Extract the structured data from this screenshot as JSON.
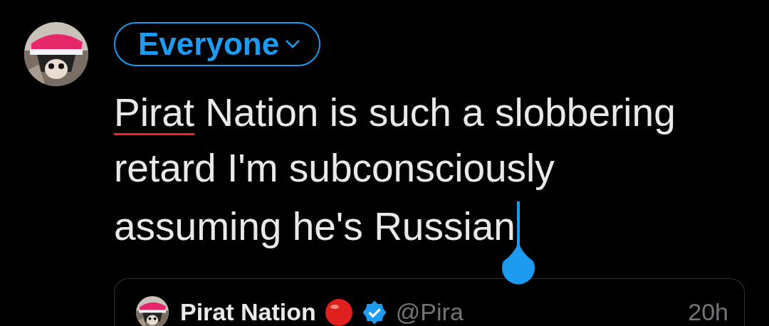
{
  "audience_button": {
    "label": "Everyone"
  },
  "compose": {
    "lines": [
      [
        {
          "text": "Pirat",
          "misspelled": true
        },
        {
          "text": " Nation is such a slobbering",
          "misspelled": false
        }
      ],
      [
        {
          "text": "retard I'm subconsciously",
          "misspelled": false
        }
      ],
      [
        {
          "text": "assuming he's Russian",
          "misspelled": false
        }
      ]
    ],
    "cursor": true
  },
  "quoted_tweet": {
    "name": "Pirat Nation",
    "handle": "@Pira",
    "time": "20h",
    "verified": true
  }
}
